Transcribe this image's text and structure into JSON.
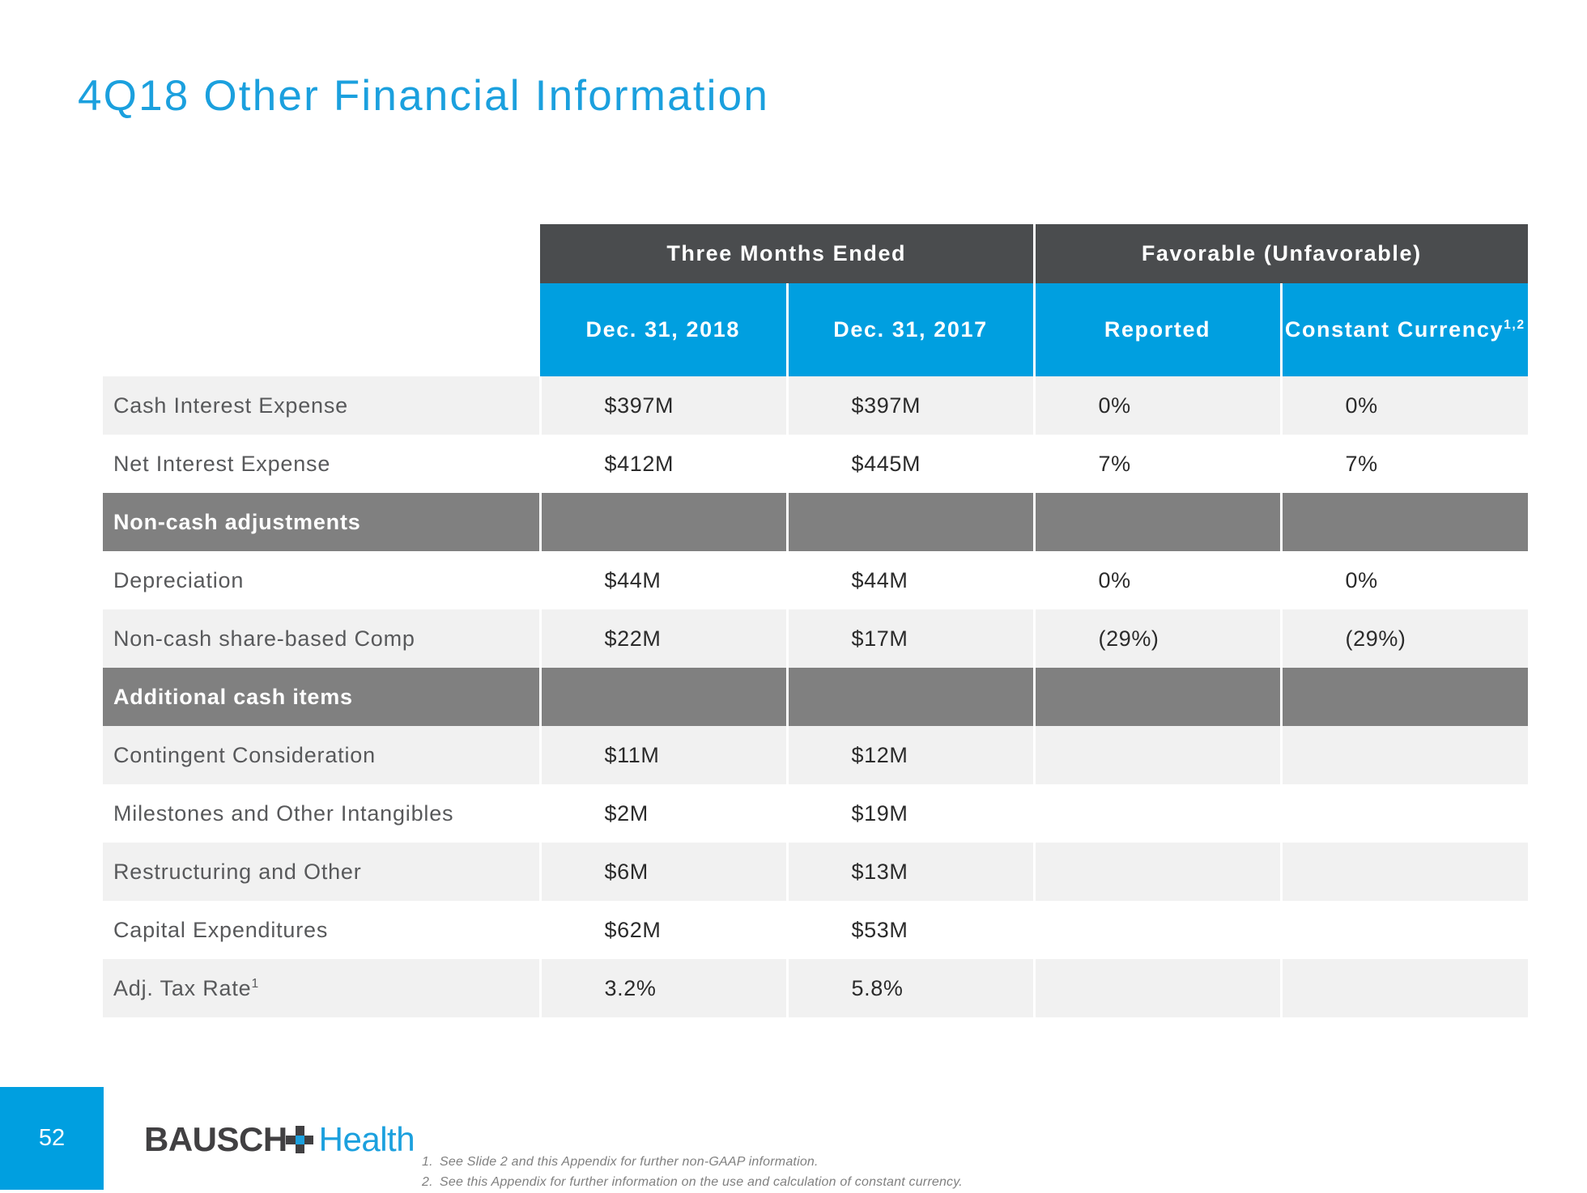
{
  "slide": {
    "title": "4Q18 Other Financial Information",
    "page_number": "52",
    "accent_color": "#009FE0",
    "title_color": "#1BA0DE",
    "header_dark_color": "#4A4C4E",
    "section_gray_color": "#808080",
    "band_color": "#F1F1F1"
  },
  "table": {
    "group_headers": [
      {
        "label": "",
        "span": 1
      },
      {
        "label": "Three Months Ended",
        "span": 2
      },
      {
        "label": "Favorable (Unfavorable)",
        "span": 2
      }
    ],
    "group_header_1": "Three Months Ended",
    "group_header_2": "Favorable (Unfavorable)",
    "columns": [
      {
        "label": ""
      },
      {
        "label": "Dec. 31, 2018"
      },
      {
        "label": "Dec. 31, 2017"
      },
      {
        "label": "Reported"
      },
      {
        "label": "Constant Currency",
        "sup": "1,2"
      }
    ],
    "col_2018": "Dec. 31, 2018",
    "col_2017": "Dec. 31, 2017",
    "col_reported": "Reported",
    "col_constant_currency": "Constant Currency",
    "col_constant_currency_sup": "1,2",
    "rows": [
      {
        "type": "data",
        "label": "Cash Interest Expense",
        "v2018": "$397M",
        "v2017": "$397M",
        "reported": "0%",
        "cc": "0%"
      },
      {
        "type": "data",
        "label": "Net Interest Expense",
        "v2018": "$412M",
        "v2017": "$445M",
        "reported": "7%",
        "cc": "7%"
      },
      {
        "type": "section",
        "label": "Non-cash adjustments",
        "v2018": "",
        "v2017": "",
        "reported": "",
        "cc": ""
      },
      {
        "type": "data",
        "label": "Depreciation",
        "v2018": "$44M",
        "v2017": "$44M",
        "reported": "0%",
        "cc": "0%"
      },
      {
        "type": "data",
        "label": "Non-cash share-based Comp",
        "v2018": "$22M",
        "v2017": "$17M",
        "reported": "(29%)",
        "cc": "(29%)"
      },
      {
        "type": "section",
        "label": "Additional cash items",
        "v2018": "",
        "v2017": "",
        "reported": "",
        "cc": ""
      },
      {
        "type": "data",
        "label": "Contingent Consideration",
        "v2018": "$11M",
        "v2017": "$12M",
        "reported": "",
        "cc": ""
      },
      {
        "type": "data",
        "label": "Milestones and Other Intangibles",
        "v2018": "$2M",
        "v2017": "$19M",
        "reported": "",
        "cc": ""
      },
      {
        "type": "data",
        "label": "Restructuring and Other",
        "v2018": "$6M",
        "v2017": "$13M",
        "reported": "",
        "cc": ""
      },
      {
        "type": "data",
        "label": "Capital Expenditures",
        "v2018": "$62M",
        "v2017": "$53M",
        "reported": "",
        "cc": ""
      },
      {
        "type": "data",
        "label": "Adj. Tax Rate",
        "label_sup": "1",
        "v2018": "3.2%",
        "v2017": "5.8%",
        "reported": "",
        "cc": ""
      }
    ]
  },
  "footnotes": [
    {
      "num": "1.",
      "text": "See Slide 2 and this Appendix for further non-GAAP information."
    },
    {
      "num": "2.",
      "text": "See this Appendix for further information on the use and calculation of constant currency."
    }
  ],
  "logo": {
    "word_dark": "BAUSCH",
    "word_blue": "Health",
    "cross_icon": "plus-cross-icon"
  }
}
